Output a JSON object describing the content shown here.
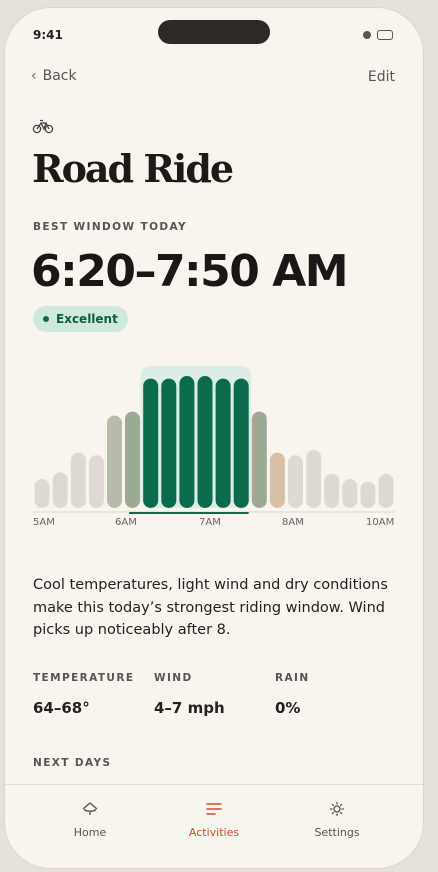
{
  "status_bar": {
    "time": "9:41"
  },
  "nav": {
    "back_label": "Back",
    "edit_label": "Edit"
  },
  "activity": {
    "icon": "bike-icon",
    "title": "Road Ride"
  },
  "best_window": {
    "label": "BEST WINDOW TODAY",
    "time_range": "6:20–7:50 AM",
    "rating": "Excellent"
  },
  "colors": {
    "accent_green": "#0b6b4c",
    "sage": "#9caa93",
    "sage_light": "#b7bba9",
    "neutral_bar": "#dedad3",
    "tan": "#d7bfa8",
    "accent_orange": "#c2552b",
    "badge_bg": "#cfe9df"
  },
  "chart_data": {
    "type": "bar",
    "tick_labels": [
      "5AM",
      "6AM",
      "7AM",
      "8AM",
      "10AM"
    ],
    "values": [
      0.22,
      0.27,
      0.42,
      0.4,
      0.7,
      0.73,
      0.98,
      0.98,
      1.0,
      1.0,
      0.98,
      0.98,
      0.73,
      0.42,
      0.4,
      0.44,
      0.26,
      0.22,
      0.2,
      0.26
    ],
    "status": [
      "neutral",
      "neutral",
      "neutral",
      "neutral",
      "sage-light",
      "sage",
      "best",
      "best",
      "best",
      "best",
      "best",
      "best",
      "sage",
      "tan",
      "neutral",
      "neutral",
      "neutral",
      "neutral",
      "neutral",
      "neutral"
    ],
    "best_window_start_index": 6,
    "best_window_end_index": 11,
    "ylim": [
      0,
      1
    ]
  },
  "description": "Cool temperatures, light wind and dry conditions make this today’s strongest riding window. Wind picks up noticeably after 8.",
  "stats": [
    {
      "label": "TEMPERATURE",
      "value": "64–68°"
    },
    {
      "label": "WIND",
      "value": "4–7 mph"
    },
    {
      "label": "RAIN",
      "value": "0%"
    }
  ],
  "next_days_label": "NEXT DAYS",
  "tabbar": {
    "tabs": [
      {
        "label": "Home",
        "icon": "home-icon",
        "active": false
      },
      {
        "label": "Activities",
        "icon": "activities-icon",
        "active": true
      },
      {
        "label": "Settings",
        "icon": "settings-icon",
        "active": false
      }
    ]
  }
}
